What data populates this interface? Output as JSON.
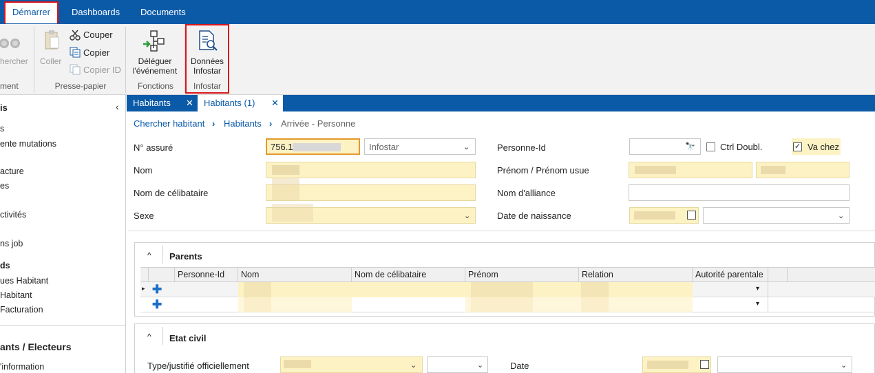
{
  "menu": {
    "tabs": [
      "Démarrer",
      "Dashboards",
      "Documents"
    ]
  },
  "ribbon": {
    "search_label": "hercher",
    "group1_label": "ment",
    "paste_label": "Coller",
    "cut_label": "Couper",
    "copy_label": "Copier",
    "copy_id_label": "Copier ID",
    "group2_label": "Presse-papier",
    "delegate_line1": "Déléguer",
    "delegate_line2": "l'événement",
    "group3_label": "Fonctions",
    "infostar_line1": "Données",
    "infostar_line2": "Infostar",
    "group4_label": "Infostar"
  },
  "sidebar": {
    "heading": "is",
    "items": [
      "s",
      "ente mutations",
      "",
      "acture",
      "es",
      "",
      "ctivités",
      "",
      "ns job"
    ],
    "section2": "ds",
    "items2": [
      "ues Habitant",
      "Habitant",
      "Facturation"
    ],
    "section3": "ants / Electeurs",
    "items3": [
      "'information"
    ]
  },
  "doc_tabs": [
    "Habitants",
    "Habitants (1)"
  ],
  "breadcrumb": [
    "Chercher habitant",
    "Habitants",
    "Arrivée - Personne"
  ],
  "form": {
    "assure_label": "N° assuré",
    "assure_value": "756.1",
    "source_select": "Infostar",
    "nom_label": "Nom",
    "celibataire_label": "Nom de célibataire",
    "sexe_label": "Sexe",
    "personne_id_label": "Personne-Id",
    "ctrl_doubl_label": "Ctrl Doubl.",
    "va_chez_label": "Va chez",
    "prenom_label": "Prénom / Prénom usu⁠el",
    "alliance_label": "Nom d'alliance",
    "naissance_label": "Date de naissance"
  },
  "parents": {
    "title": "Parents",
    "columns": [
      "Personne-Id",
      "Nom",
      "Nom de célibataire",
      "Prénom",
      "Relation",
      "Autorité parentale"
    ]
  },
  "etat_civil": {
    "title": "Etat civil",
    "type_label": "Type/justifié officiellement",
    "date_label": "Date"
  },
  "colors": {
    "brand": "#0b5aa8",
    "highlight_border": "#d9151b",
    "required_field": "#fdf2c4"
  }
}
